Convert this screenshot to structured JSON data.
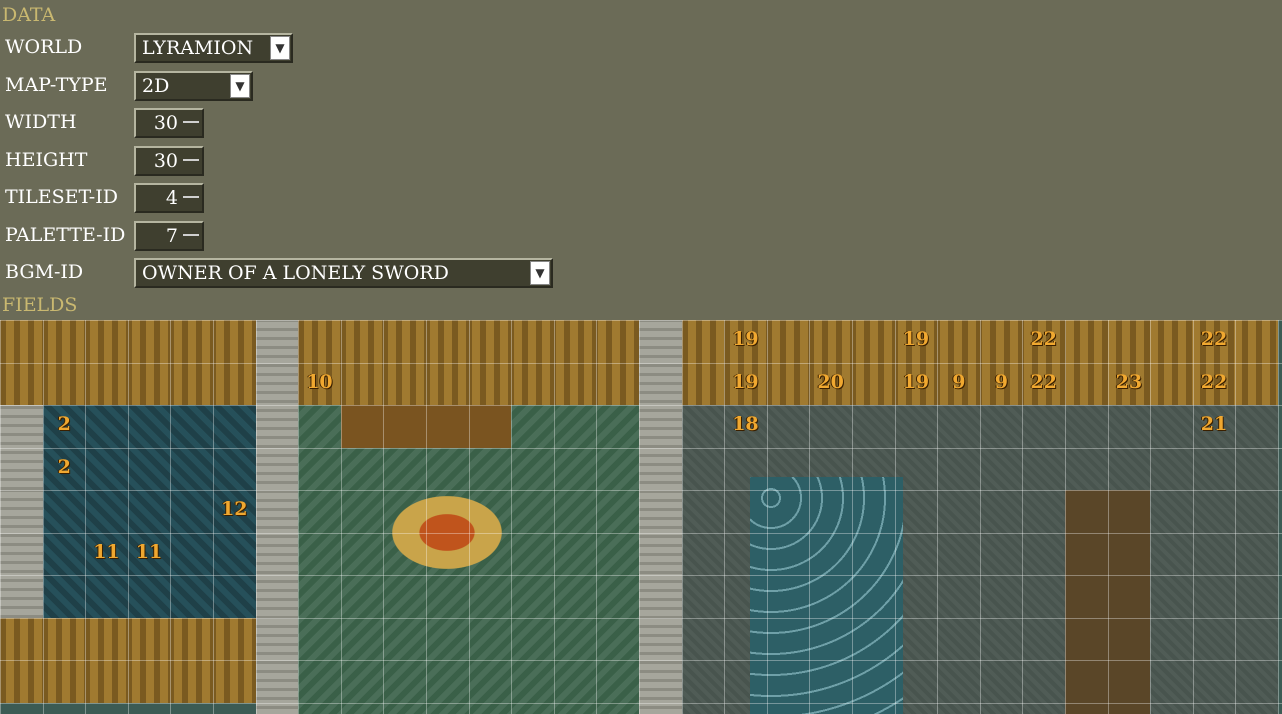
{
  "data_section": {
    "title": "DATA"
  },
  "world": {
    "label": "WORLD",
    "value": "LYRAMION"
  },
  "map_type": {
    "label": "MAP-TYPE",
    "value": "2D"
  },
  "width": {
    "label": "WIDTH",
    "value": "30"
  },
  "height": {
    "label": "HEIGHT",
    "value": "30"
  },
  "tileset_id": {
    "label": "TILESET-ID",
    "value": "4"
  },
  "palette_id": {
    "label": "PALETTE-ID",
    "value": "7"
  },
  "bgm_id": {
    "label": "BGM-ID",
    "value": "OWNER OF A LONELY SWORD"
  },
  "fields_section": {
    "title": "FIELDS"
  },
  "event_markers": [
    "19",
    "19",
    "22",
    "22",
    "10",
    "19",
    "20",
    "19",
    "9",
    "9",
    "22",
    "23",
    "22",
    "2",
    "18",
    "21",
    "2",
    "12",
    "11",
    "11"
  ],
  "colors": {
    "background": "#6b6b57",
    "section_title": "#c9b870",
    "input_bg": "#3f3f2f",
    "event_number": "#f0a830",
    "water_floor": "#2f4f58",
    "stone_wall": "#9a9a90",
    "wood_wall": "#8a6a28",
    "tile_floor": "#3c5b54",
    "dark_floor": "#4a5650",
    "carpet": "#5a4628",
    "mosaic": "#2d5f66"
  }
}
